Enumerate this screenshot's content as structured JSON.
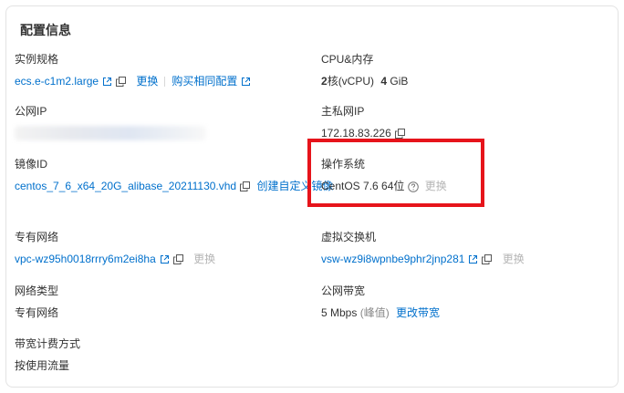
{
  "card": {
    "title": "配置信息"
  },
  "instance_spec": {
    "label": "实例规格",
    "value": "ecs.e-c1m2.large",
    "change": "更换",
    "buy_same": "购买相同配置"
  },
  "cpu_memory": {
    "label": "CPU&内存",
    "cores": "2",
    "cores_unit": "核(vCPU)",
    "memory": "4",
    "memory_unit": "GiB"
  },
  "public_ip": {
    "label": "公网IP"
  },
  "private_ip": {
    "label": "主私网IP",
    "value": "172.18.83.226"
  },
  "image_id": {
    "label": "镜像ID",
    "value": "centos_7_6_x64_20G_alibase_20211130.vhd",
    "create_custom": "创建自定义镜像"
  },
  "os": {
    "label": "操作系统",
    "value": "CentOS 7.6 64位",
    "change": "更换"
  },
  "vpc": {
    "label": "专有网络",
    "value": "vpc-wz95h0018rrry6m2ei8ha",
    "change": "更换"
  },
  "vswitch": {
    "label": "虚拟交换机",
    "value": "vsw-wz9i8wpnbe9phr2jnp281",
    "change": "更换"
  },
  "network_type": {
    "label": "网络类型",
    "value": "专有网络"
  },
  "bandwidth": {
    "label": "公网带宽",
    "value": "5 Mbps",
    "peak": "(峰值)",
    "change": "更改带宽"
  },
  "billing": {
    "label": "带宽计费方式",
    "value": "按使用流量"
  },
  "icons": {
    "external": "external-link-icon",
    "copy": "copy-icon",
    "help": "question-circle-icon"
  },
  "colors": {
    "link": "#0070cc",
    "highlight": "#e6141b",
    "muted": "#b5b5b5"
  }
}
